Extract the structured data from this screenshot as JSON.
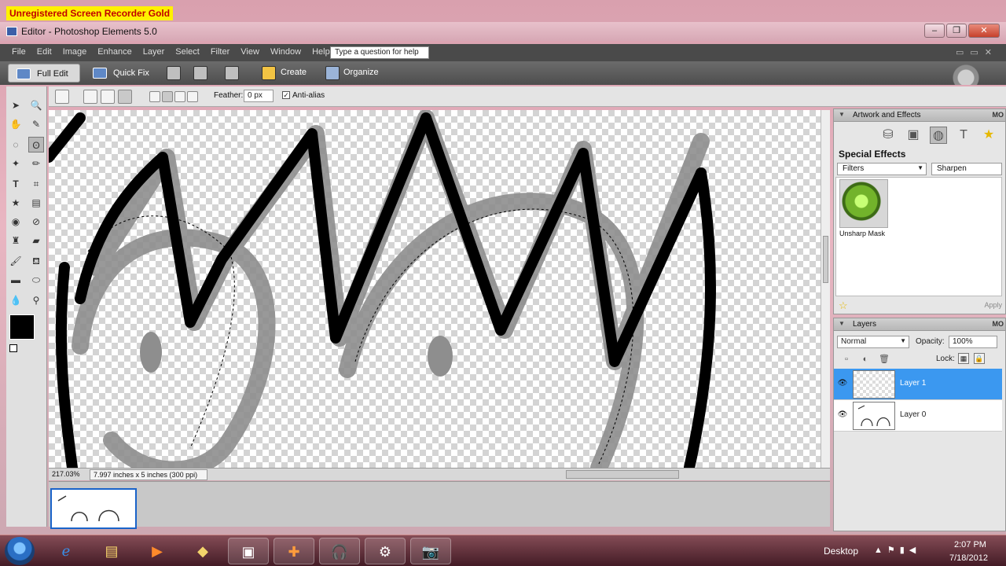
{
  "watermark": "Unregistered Screen Recorder Gold",
  "window": {
    "title": "Editor - Photoshop Elements 5.0"
  },
  "menu": {
    "items": [
      "File",
      "Edit",
      "Image",
      "Enhance",
      "Layer",
      "Select",
      "Filter",
      "View",
      "Window",
      "Help"
    ],
    "help_placeholder": "Type a question for help"
  },
  "modebar": {
    "full_edit": "Full Edit",
    "quick_fix": "Quick Fix",
    "create": "Create",
    "organize": "Organize"
  },
  "options": {
    "feather_label": "Feather:",
    "feather_value": "0 px",
    "antialias_label": "Anti-alias",
    "antialias_checked": true
  },
  "status": {
    "zoom": "217.03%",
    "doc_size": "7.997 inches x 5 inches (300 ppi)"
  },
  "artwork_effects": {
    "title": "Artwork and Effects",
    "more": "MO",
    "section": "Special Effects",
    "category": "Filters",
    "subcategory": "Sharpen",
    "effects": [
      {
        "label": "Unsharp Mask"
      }
    ],
    "apply": "Apply"
  },
  "layers": {
    "title": "Layers",
    "more": "MO",
    "blend_mode": "Normal",
    "opacity_label": "Opacity:",
    "opacity_value": "100%",
    "lock_label": "Lock:",
    "items": [
      {
        "name": "Layer 1",
        "active": true
      },
      {
        "name": "Layer 0",
        "active": false
      }
    ]
  },
  "taskbar": {
    "desktop": "Desktop",
    "time": "2:07 PM",
    "date": "7/18/2012"
  },
  "colors": {
    "selection_blue": "#3b98f0",
    "menubar": "#4a4a4a",
    "watermark_bg": "#fff100",
    "watermark_fg": "#c00000"
  }
}
